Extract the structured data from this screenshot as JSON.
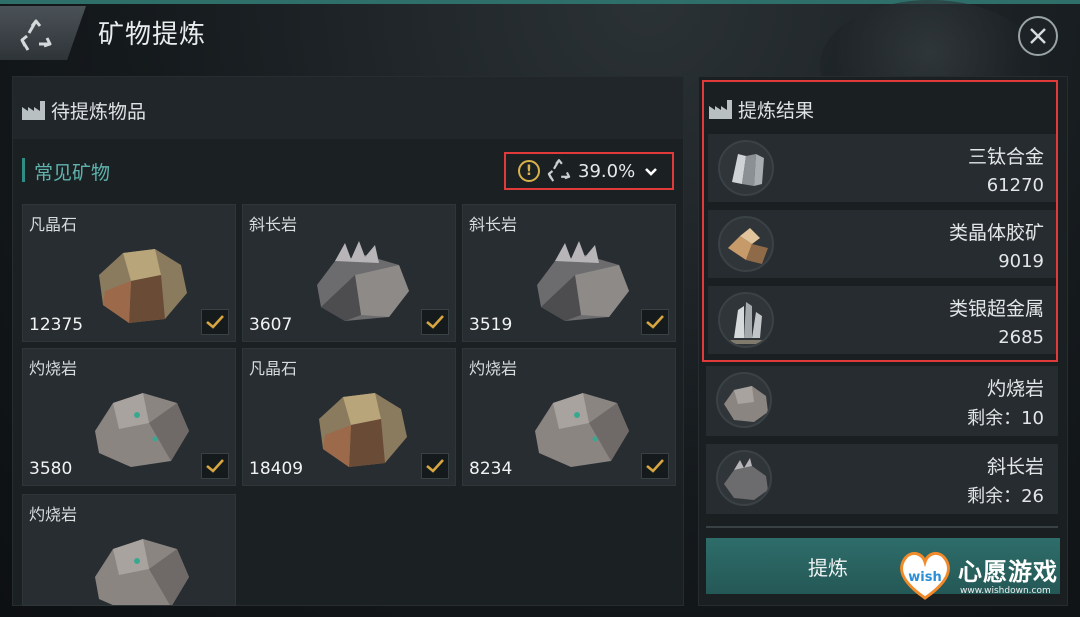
{
  "header": {
    "title": "矿物提炼",
    "close_icon": "close-icon",
    "refine_icon": "recycle-icon"
  },
  "input_section": {
    "title": "待提炼物品",
    "category": "常见矿物",
    "rate": "39.0%",
    "items": [
      {
        "name": "凡晶石",
        "count": "12375",
        "checked": true
      },
      {
        "name": "斜长岩",
        "count": "3607",
        "checked": true
      },
      {
        "name": "斜长岩",
        "count": "3519",
        "checked": true
      },
      {
        "name": "灼烧岩",
        "count": "3580",
        "checked": true
      },
      {
        "name": "凡晶石",
        "count": "18409",
        "checked": true
      },
      {
        "name": "灼烧岩",
        "count": "8234",
        "checked": true
      },
      {
        "name": "灼烧岩",
        "count": "",
        "checked": true
      }
    ]
  },
  "result_section": {
    "title": "提炼结果",
    "results": [
      {
        "name": "三钛合金",
        "value": "61270"
      },
      {
        "name": "类晶体胶矿",
        "value": "9019"
      },
      {
        "name": "类银超金属",
        "value": "2685"
      }
    ],
    "leftovers": [
      {
        "name": "灼烧岩",
        "remain": "剩余：10"
      },
      {
        "name": "斜长岩",
        "remain": "剩余：26"
      }
    ],
    "refine_button": "提炼"
  },
  "watermark": {
    "brand": "wish",
    "text": "心愿游戏",
    "url": "www.wishdown.com"
  },
  "colors": {
    "accent": "#2f8d86",
    "highlight_border": "#e03a3a",
    "check": "#d8a640"
  }
}
